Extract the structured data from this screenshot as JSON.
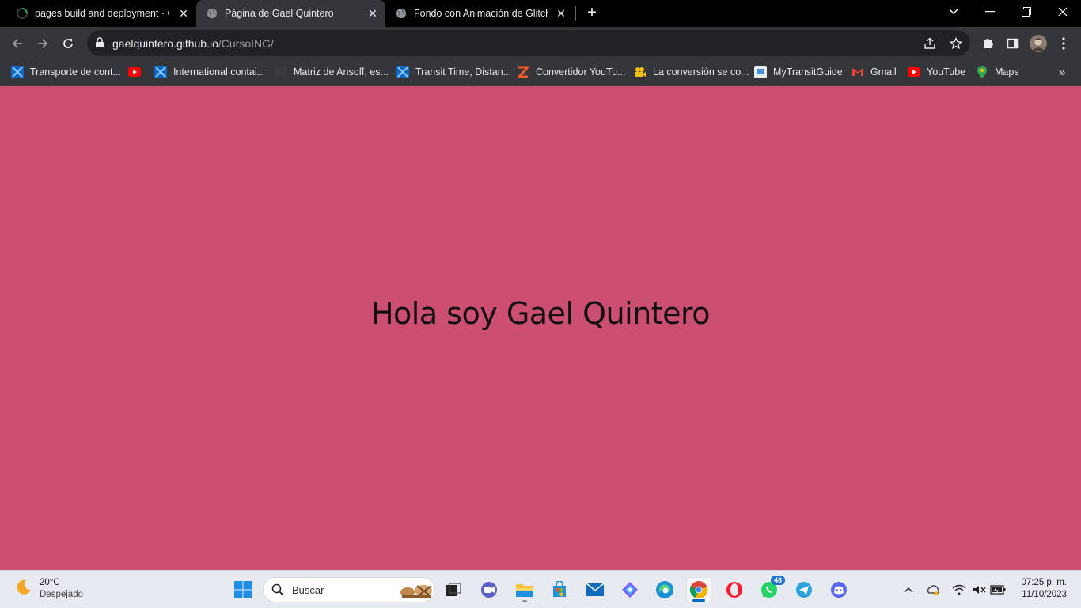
{
  "browser": {
    "tabs": [
      {
        "title": "pages build and deployment · G",
        "favicon": "loading-spinner-icon"
      },
      {
        "title": "Página de Gael Quintero",
        "favicon": "globe-icon"
      },
      {
        "title": "Fondo con Animación de Glitch",
        "favicon": "globe-icon"
      }
    ],
    "url_domain": "gaelquintero.github.io",
    "url_path": "/CursoING/",
    "bookmarks": [
      "Transporte de cont...",
      "",
      "International contai...",
      "Matriz de Ansoff, es...",
      "Transit Time, Distan...",
      "Convertidor YouTu...",
      "La conversión se co...",
      "MyTransitGuide",
      "Gmail",
      "YouTube",
      "Maps"
    ]
  },
  "page": {
    "heading": "Hola soy Gael Quintero",
    "background_color": "#cc4e71"
  },
  "taskbar": {
    "weather_temp": "20°C",
    "weather_condition": "Despejado",
    "search_placeholder": "Buscar",
    "whatsapp_badge": "48",
    "time": "07:25 p. m.",
    "date": "11/10/2023"
  }
}
